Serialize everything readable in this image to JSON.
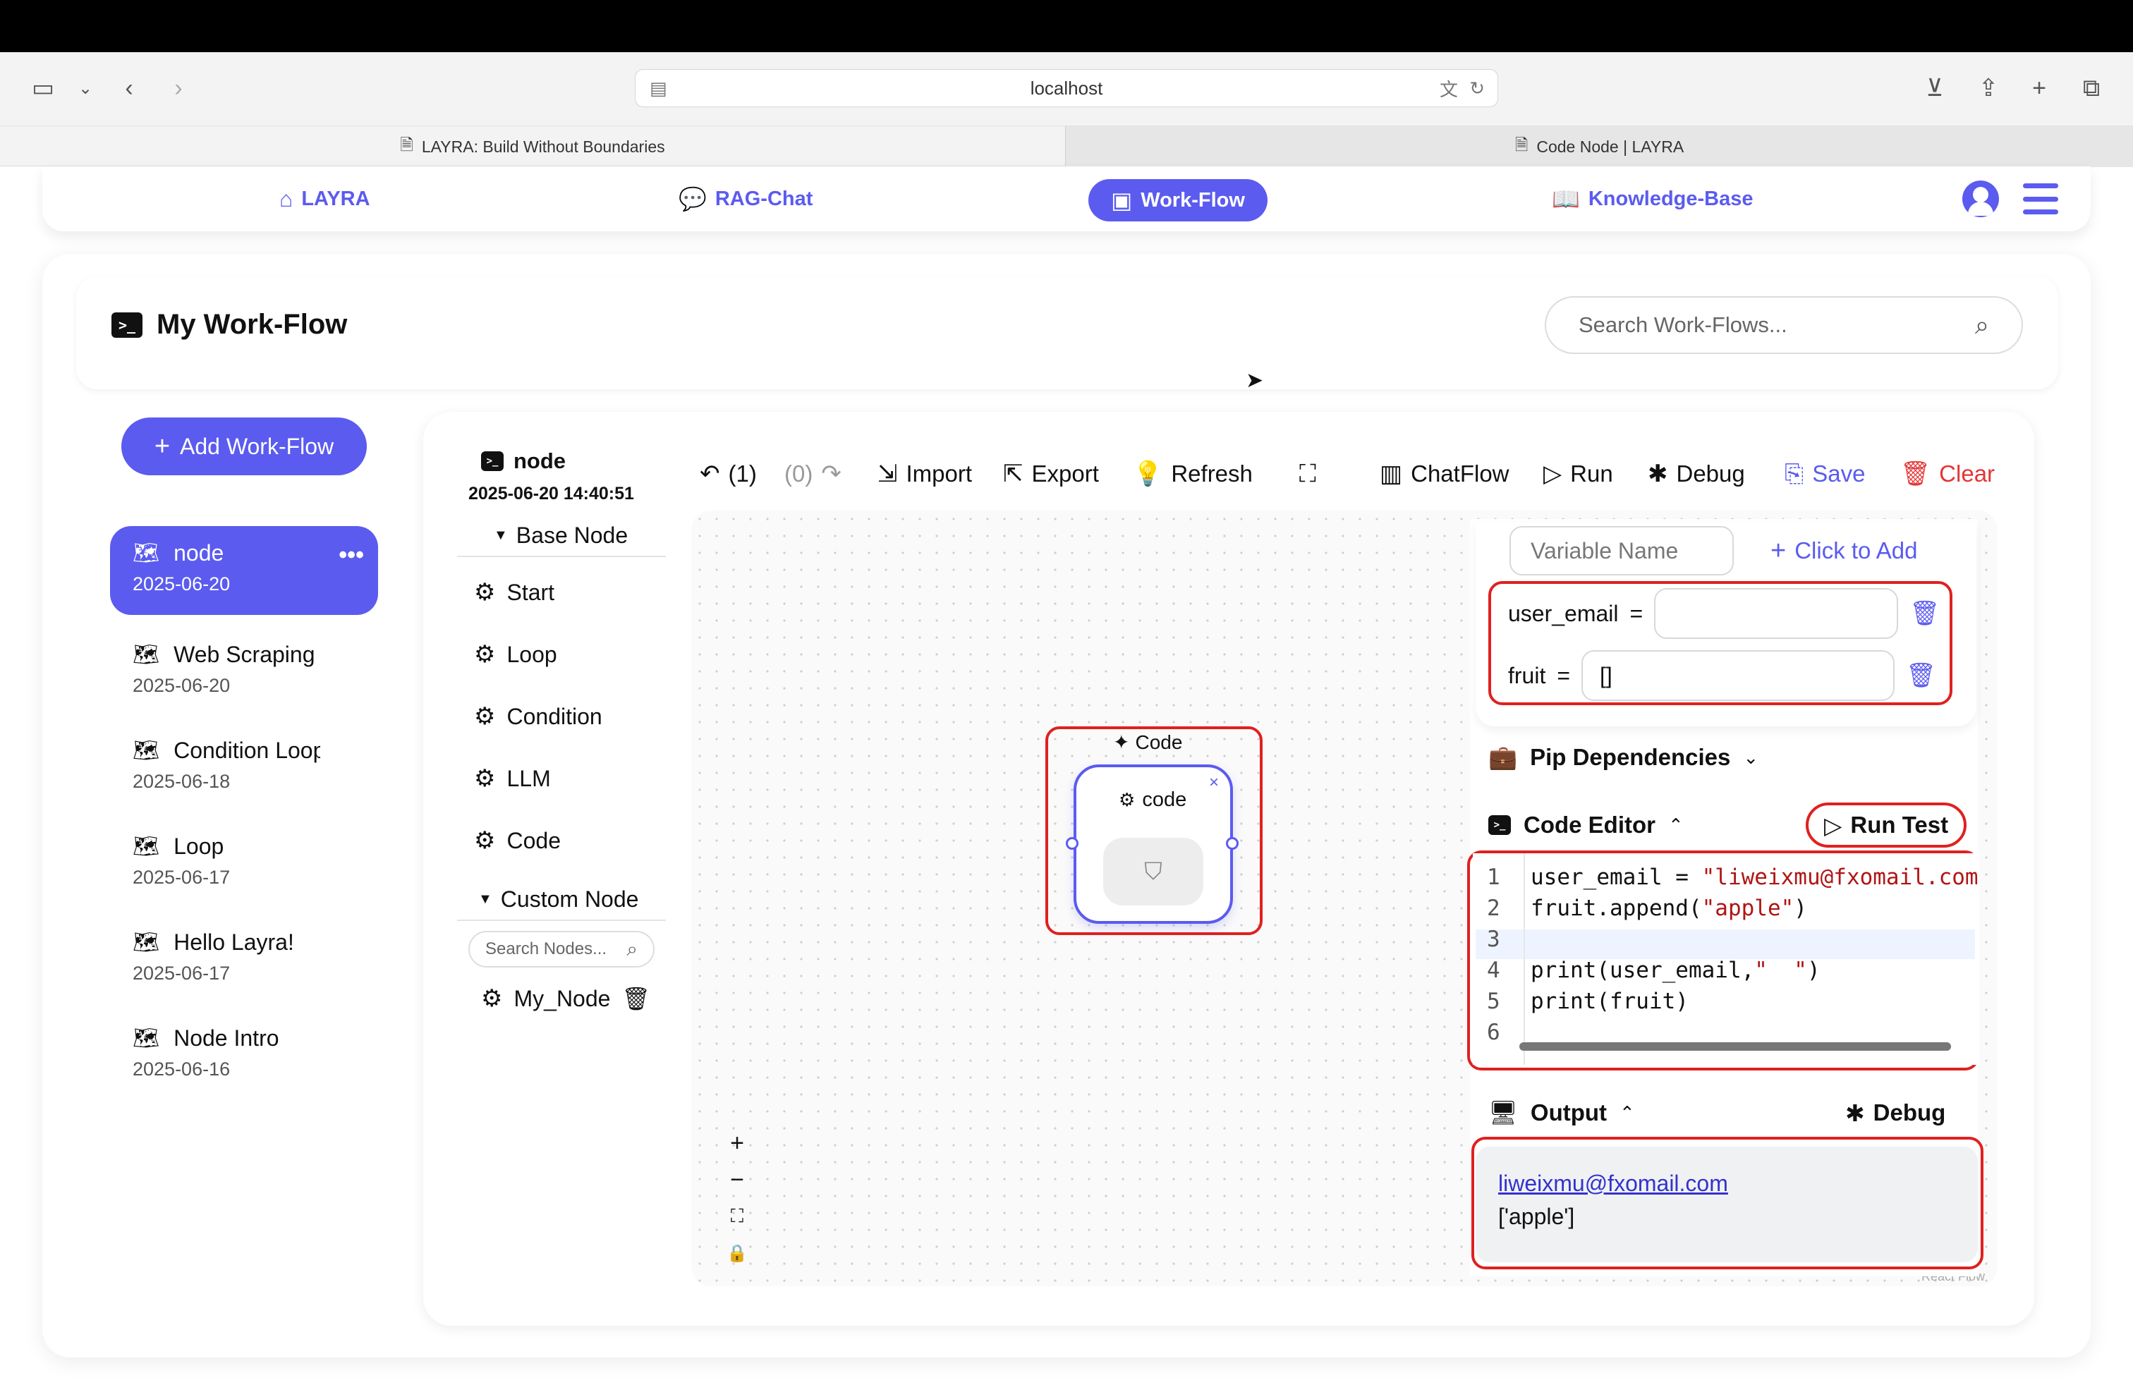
{
  "browser": {
    "url": "localhost",
    "tabs": [
      {
        "label": "LAYRA: Build Without Boundaries"
      },
      {
        "label": "Code Node | LAYRA"
      }
    ]
  },
  "nav": {
    "items": [
      {
        "label": "LAYRA",
        "icon": "home-icon"
      },
      {
        "label": "RAG-Chat",
        "icon": "chat-icon"
      },
      {
        "label": "Work-Flow",
        "icon": "terminal-icon"
      },
      {
        "label": "Knowledge-Base",
        "icon": "book-icon"
      }
    ]
  },
  "page": {
    "title": "My Work-Flow",
    "search_placeholder": "Search Work-Flows..."
  },
  "sidebar": {
    "add_label": "Add Work-Flow",
    "workflows": [
      {
        "name": "node",
        "date": "2025-06-20"
      },
      {
        "name": "Web Scraping",
        "date": "2025-06-20"
      },
      {
        "name": "Condition Loop",
        "date": "2025-06-18"
      },
      {
        "name": "Loop",
        "date": "2025-06-17"
      },
      {
        "name": "Hello Layra!",
        "date": "2025-06-17"
      },
      {
        "name": "Node Intro",
        "date": "2025-06-16"
      }
    ]
  },
  "palette": {
    "workflow_name": "node",
    "workflow_datetime": "2025-06-20 14:40:51",
    "base_section": "Base Node",
    "base_nodes": [
      "Start",
      "Loop",
      "Condition",
      "LLM",
      "Code"
    ],
    "custom_section": "Custom Node",
    "search_placeholder": "Search Nodes...",
    "custom_nodes": [
      "My_Node"
    ]
  },
  "toolbar": {
    "undo": "(1)",
    "redo": "(0)",
    "import": "Import",
    "export": "Export",
    "refresh": "Refresh",
    "chatflow": "ChatFlow",
    "run": "Run",
    "debug": "Debug",
    "save": "Save",
    "clear": "Clear"
  },
  "canvas": {
    "node_type": "Code",
    "node_label": "code",
    "watermark": "React Flow"
  },
  "panel": {
    "variable_placeholder": "Variable Name",
    "add_label": "Click to Add",
    "variables": [
      {
        "name": "user_email",
        "value": ""
      },
      {
        "name": "fruit",
        "value": "[]"
      }
    ],
    "pip_label": "Pip Dependencies",
    "code_editor_label": "Code Editor",
    "run_test_label": "Run Test",
    "code_lines": [
      {
        "n": "1",
        "pre": "user_email = ",
        "str": "\"liweixmu@fxomail.com\"",
        "post": ""
      },
      {
        "n": "2",
        "pre": "fruit.append(",
        "str": "\"apple\"",
        "post": ")"
      },
      {
        "n": "3",
        "pre": "",
        "str": "",
        "post": ""
      },
      {
        "n": "4",
        "pre": "print(user_email,",
        "str": "\"  \"",
        "post": ")"
      },
      {
        "n": "5",
        "pre": "print(fruit)",
        "str": "",
        "post": ""
      },
      {
        "n": "6",
        "pre": "",
        "str": "",
        "post": ""
      }
    ],
    "output_label": "Output",
    "debug_label": "Debug",
    "output_lines": [
      "liweixmu@fxomail.com",
      "['apple']"
    ]
  }
}
